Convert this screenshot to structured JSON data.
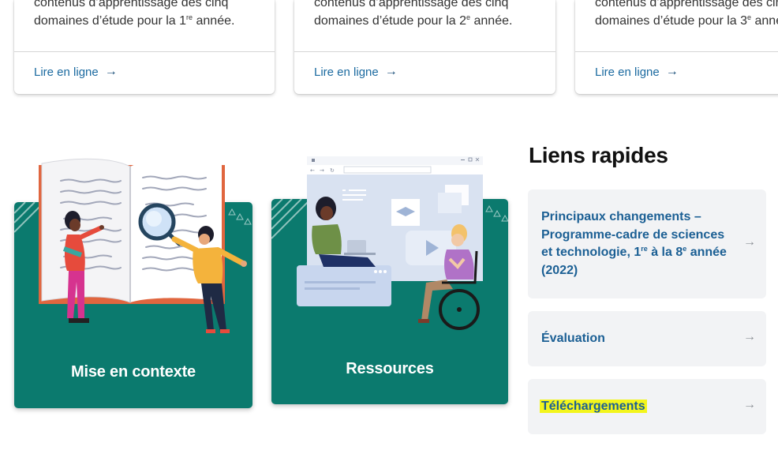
{
  "top_cards": [
    {
      "desc_line1": "contenus d’apprentissage des cinq",
      "desc_line2_pre": "domaines d’étude pour la 1",
      "desc_line2_sup": "re",
      "desc_line2_post": " année.",
      "link_label": "Lire en ligne"
    },
    {
      "desc_line1": "contenus d’apprentissage des cinq",
      "desc_line2_pre": "domaines d’étude pour la 2",
      "desc_line2_sup": "e",
      "desc_line2_post": " année.",
      "link_label": "Lire en ligne"
    },
    {
      "desc_line1": "contenus d’apprentissage des cinq",
      "desc_line2_pre": "domaines d’étude pour la 3",
      "desc_line2_sup": "e",
      "desc_line2_post": " année.",
      "link_label": "Lire en ligne"
    }
  ],
  "feature_cards": [
    {
      "title": "Mise en contexte"
    },
    {
      "title": "Ressources"
    }
  ],
  "quick_links": {
    "heading": "Liens rapides",
    "items": [
      {
        "line1": "Principaux changements –",
        "line2": "Programme-cadre de sciences",
        "line3_pre": "et technologie, 1",
        "line3_sup": "re",
        "line3_mid": " à la 8",
        "line3_sup2": "e",
        "line3_post": " année",
        "line4": "(2022)"
      },
      {
        "label": "Évaluation"
      },
      {
        "label": "Téléchargements",
        "highlighted": true
      }
    ]
  },
  "icons": {
    "link_arrow": "arrow-right-icon",
    "quick_link_arrow": "arrow-right-thin-icon"
  },
  "colors": {
    "teal": "#0b7a6e",
    "link_blue": "#1b6aa0",
    "quick_link_bg": "#f2f3f5",
    "highlight": "#f3f51c"
  }
}
